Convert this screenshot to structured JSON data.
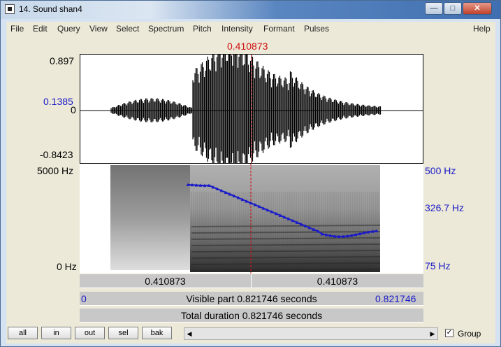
{
  "window": {
    "title": "14. Sound shan4"
  },
  "menu": [
    "File",
    "Edit",
    "Query",
    "View",
    "Select",
    "Spectrum",
    "Pitch",
    "Intensity",
    "Formant",
    "Pulses",
    "Help"
  ],
  "cursor": {
    "time": "0.410873",
    "value": "0.1385"
  },
  "waveform": {
    "max": "0.897",
    "zero": "0",
    "min": "-0.8423"
  },
  "spectrogram": {
    "top": "5000 Hz",
    "bottom": "0 Hz"
  },
  "pitch": {
    "top": "500 Hz",
    "mid": "326.7 Hz",
    "bottom": "75 Hz"
  },
  "selection": {
    "left": "0.410873",
    "right": "0.410873"
  },
  "visible": {
    "start": "0",
    "label": "Visible part 0.821746 seconds",
    "end": "0.821746"
  },
  "total": {
    "label": "Total duration 0.821746 seconds"
  },
  "buttons": {
    "all": "all",
    "in": "in",
    "out": "out",
    "sel": "sel",
    "bak": "bak"
  },
  "group": {
    "label": "Group",
    "checked": true
  },
  "icons": {
    "minimize": "minimize-icon",
    "maximize": "maximize-icon",
    "close": "close-icon"
  }
}
